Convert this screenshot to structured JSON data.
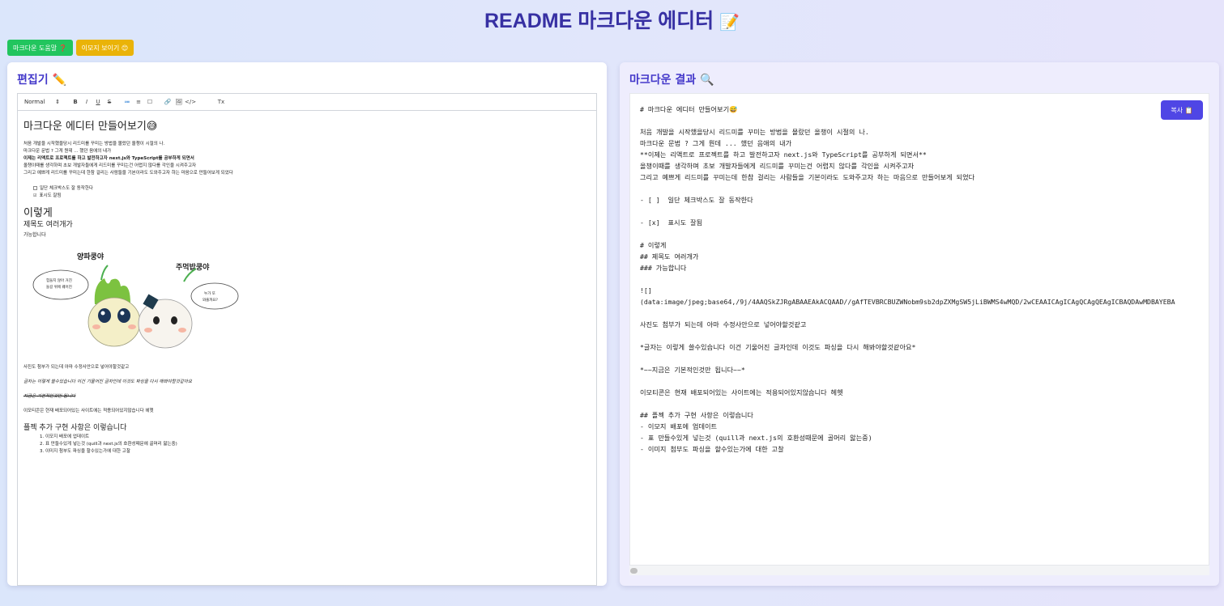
{
  "app": {
    "title": "README 마크다운 에디터",
    "title_emoji": "📝"
  },
  "top_buttons": {
    "help_label": "마크다운 도움말 ❓",
    "emoji_label": "이모지 보이기 😊"
  },
  "editor_panel": {
    "title": "편집기 ✏️",
    "toolbar": {
      "format_select": "Normal",
      "buttons": [
        "B",
        "I",
        "U",
        "S",
        "≔",
        "≡",
        "☐",
        "🔗",
        "🖼",
        "</>",
        "Tx"
      ]
    },
    "content": {
      "h1": "마크다운 에디터 만들어보기😅",
      "lines": [
        "처음 개발을 시작했을당시 리드미를 꾸미는 방법을 몰랐던 올챙이 시절의 나.",
        "마크다운 문법 ? 그게 뭔데 ... 했던 음애의 내가"
      ],
      "bold_line": "이제는 리액트로 프로젝트를 하고 발전하고자 next.js와 TypeScript를 공부하게 되면서",
      "lines2": [
        "올챙이때를 생각하며 초보 개발자들에게 리드미를 꾸미는건 어렵지 않다를 각인을 시켜주고자",
        "그리고 예쁘게 리드미를 꾸미는데 한참 걸리는 사람들을 기본이라도 도와주고자 하는 마음으로 만들어보게 되었다"
      ],
      "checks": [
        "일단 체크박스도 잘 동작한다",
        "표시도 잘됨"
      ],
      "h1b": "이렇게",
      "h2": "제목도 여러개가",
      "h3": "가능합니다",
      "image_caption_left": "양파쿵야",
      "image_caption_right": "주먹밥쿵야",
      "bubble_left": "힘들지 않아 거친 들길 위에 꿰어진 건 나니까 양오게",
      "bubble_right": "누가 또 와줄까요?",
      "para1": "사진도 첨부가 되는데 아마 수정사안으로 넣어야할것같고",
      "para2": "글자는 이렇게 쓸수있습니다 이건 기울어진 글자인데 이것도 파싱을 다시 해봐야할것같아요",
      "para3": "지금은 기본적인것만 됩니다",
      "para4": "이모티콘은 현재 배포되어있는 사이트에는 적용되어있지않습니다 헤헷",
      "h2b": "플젝 추가 구현 사항은 이렇습니다",
      "ol": [
        "1. 이모지 배포에 업데이트",
        "2. 표 만들수있게 넣는것 (quill과 next.js의 호환성때문에 골머리 앓는중)",
        "3. 이미지 첨부도 파싱을 할수있는가에 대한 고찰"
      ]
    }
  },
  "result_panel": {
    "title": "마크다운 결과 🔍",
    "copy_label": "복사 📋",
    "markdown_lines": [
      "# 마크다운 에디터 만들어보기😅",
      "",
      "처음 개발을 시작했을당시 리드미를 꾸미는 방법을 몰랐던 올챙이 시절의 나.",
      "마크다운 문법 ? 그게 뭔데 ... 했던 음애의 내가",
      "**이제는 리액트로 프로젝트를 하고 발전하고자 next.js와 TypeScript를 공부하게 되면서**",
      "올챙이때를 생각하며 초보 개발자들에게 리드미를 꾸미는건 어렵지 않다를 각인을 시켜주고자",
      "그리고 예쁘게 리드미를 꾸미는데 한참 걸리는 사람들을 기본이라도 도와주고자 하는 마음으로 만들어보게 되었다",
      "",
      "- [ ]  일단 체크박스도 잘 동작한다",
      "",
      "- [x]  표시도 잘됨",
      "",
      "# 이렇게",
      "## 제목도 여러개가",
      "### 가능합니다",
      "",
      "![]",
      "(data:image/jpeg;base64,/9j/4AAQSkZJRgABAAEAkACQAAD//gAfTEVBRCBUZWNobm9sb2dpZXMgSW5jLiBWMS4wMQD/2wCEAAICAgICAgQCAgQEAgICBAQDAwMDBAYEBA",
      "",
      "사진도 첨부가 되는데 아마 수정사안으로 넣어야할것같고",
      "",
      "*글자는 이렇게 쓸수있습니다 이건 기울어진 글자인데 이것도 파싱을 다시 해봐야할것같아요*",
      "",
      "*~~지금은 기본적인것만 됩니다~~*",
      "",
      "이모티콘은 현재 배포되어있는 사이트에는 적용되어있지않습니다 헤헷",
      "",
      "## 플젝 추가 구현 사항은 이렇습니다",
      "- 이모지 배포에 업데이트",
      "- 표 만들수있게 넣는것 (quill과 next.js의 호환성때문에 골머리 앓는중)",
      "- 이미지 첨부도 파싱을 할수있는가에 대한 고찰"
    ]
  }
}
